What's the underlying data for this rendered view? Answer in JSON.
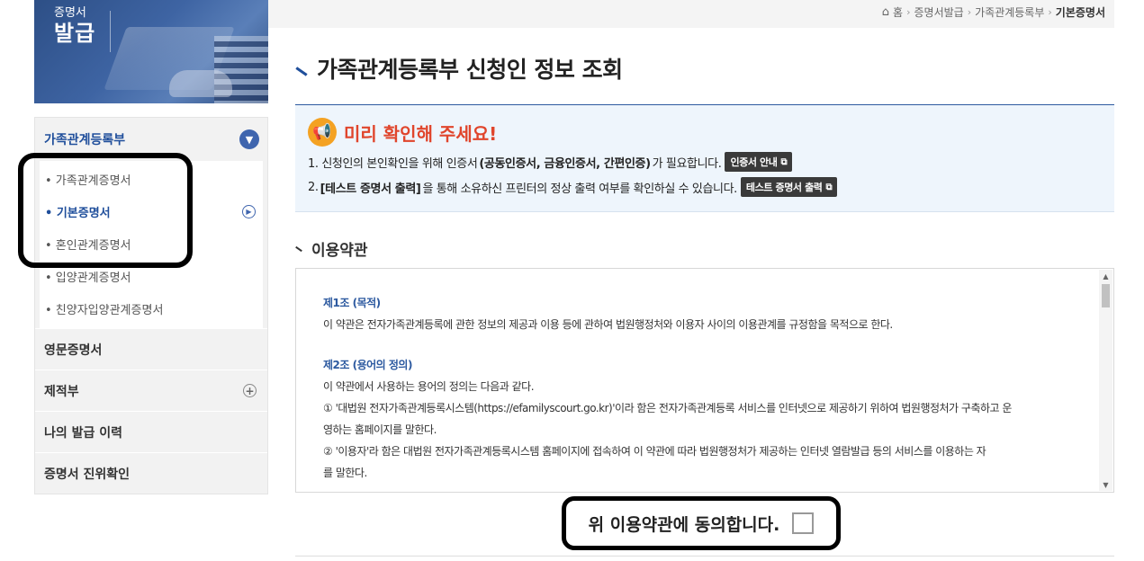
{
  "banner": {
    "title_small": "증명서",
    "title_big": "발급"
  },
  "sidebar": {
    "group_label": "가족관계등록부",
    "sub_items": [
      {
        "label": "• 가족관계증명서"
      },
      {
        "label": "• 기본증명서"
      },
      {
        "label": "• 혼인관계증명서"
      },
      {
        "label": "• 입양관계증명서"
      },
      {
        "label": "• 친양자입양관계증명서"
      }
    ],
    "rows": [
      {
        "label": "영문증명서"
      },
      {
        "label": "제적부"
      },
      {
        "label": "나의 발급 이력"
      },
      {
        "label": "증명서 진위확인"
      }
    ]
  },
  "breadcrumb": {
    "home": "홈",
    "level1": "증명서발급",
    "level2": "가족관계등록부",
    "current": "기본증명서"
  },
  "page_title": "가족관계등록부 신청인 정보 조회",
  "notice": {
    "title": "미리 확인해 주세요!",
    "line1_pre": "1. 신청인의 본인확인을 위해 인증서",
    "line1_bold": "(공동인증서, 금융인증서, 간편인증)",
    "line1_post": "가 필요합니다.",
    "line1_button": "인증서 안내",
    "line2_pre": "2. ",
    "line2_bold": "[테스트 증명서 출력]",
    "line2_post": "을 통해 소유하신 프린터의 정상 출력 여부를 확인하실 수 있습니다.",
    "line2_button": "테스트 증명서 출력"
  },
  "terms": {
    "section_title": "이용약관",
    "art1_title": "제1조 (목적)",
    "art1_text": "이 약관은 전자가족관계등록에 관한 정보의 제공과 이용 등에 관하여 법원행정처와 이용자 사이의 이용관계를 규정함을 목적으로 한다.",
    "art2_title": "제2조 (용어의 정의)",
    "art2_intro": "이 약관에서 사용하는 용어의 정의는 다음과 같다.",
    "art2_item1a": "① '대법원 전자가족관계등록시스템(https://efamilyscourt.go.kr)'이라 함은 전자가족관계등록 서비스를 인터넷으로 제공하기 위하여 법원행정처가 구축하고 운",
    "art2_item1b": "영하는 홈페이지를 말한다.",
    "art2_item2a": "② '이용자'라 함은 대법원 전자가족관계등록시스템 홈페이지에 접속하여 이 약관에 따라 법원행정처가 제공하는 인터넷 열람발급 등의 서비스를 이용하는 자",
    "art2_item2b": "를 말한다."
  },
  "agree": {
    "label": "위 이용약관에 동의합니다."
  },
  "colors": {
    "primary": "#1f4e9b",
    "accent_red": "#e0452c",
    "notice_bg": "#eef5fc"
  },
  "icons": {
    "home": "home-icon",
    "chevron": "chevron-down-icon",
    "play": "play-circle-icon",
    "plus": "plus-circle-icon",
    "megaphone": "megaphone-icon",
    "external": "external-link-icon"
  }
}
